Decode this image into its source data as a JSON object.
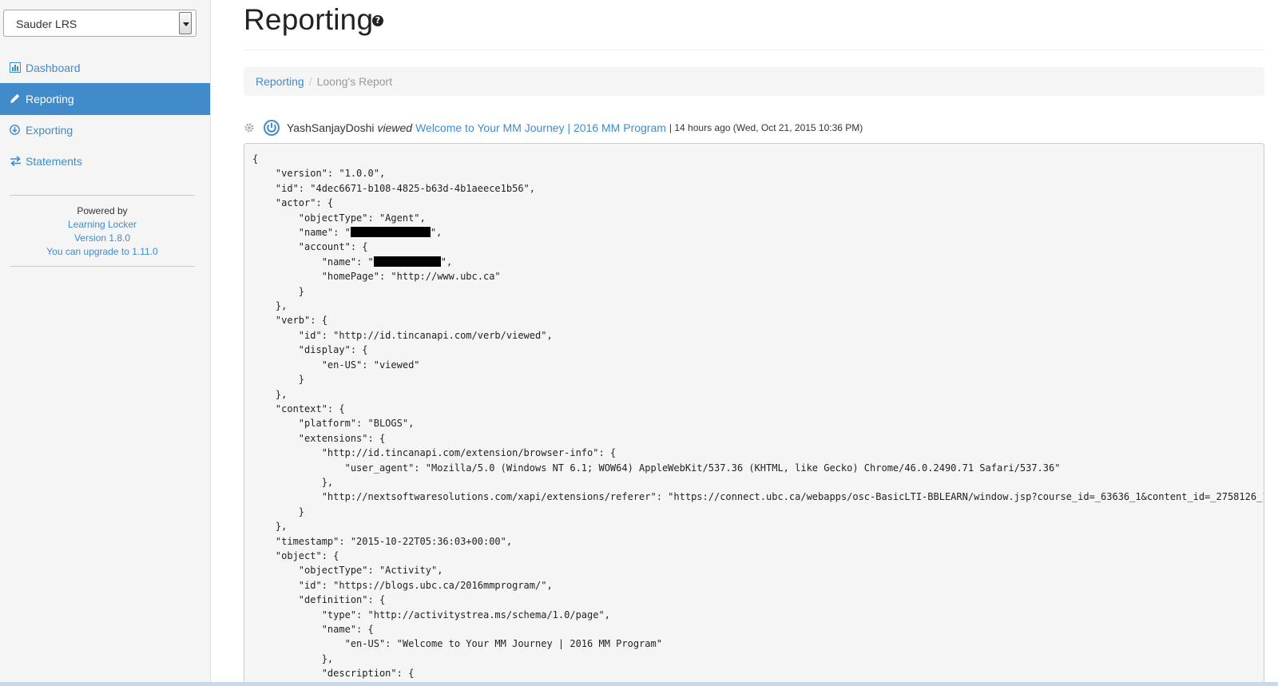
{
  "sidebar": {
    "lrs_selector": {
      "value": "Sauder LRS"
    },
    "nav": [
      {
        "label": "Dashboard",
        "icon": "bar-chart-icon",
        "active": false
      },
      {
        "label": "Reporting",
        "icon": "pencil-icon",
        "active": true
      },
      {
        "label": "Exporting",
        "icon": "download-circle-icon",
        "active": false
      },
      {
        "label": "Statements",
        "icon": "transfer-arrows-icon",
        "active": false
      }
    ],
    "powered": {
      "line1": "Powered by",
      "product": "Learning Locker",
      "version": "Version 1.8.0",
      "upgrade": "You can upgrade to 1.11.0"
    }
  },
  "header": {
    "title": "Reporting",
    "help_icon": "question-circle-icon"
  },
  "breadcrumb": {
    "parent": "Reporting",
    "separator": "/",
    "current": "Loong's Report"
  },
  "statement": {
    "actor": "YashSanjayDoshi",
    "verb": "viewed",
    "object": "Welcome to Your MM Journey | 2016 MM Program",
    "time": "| 14 hours ago (Wed, Oct 21, 2015 10:36 PM)"
  },
  "json_lines": [
    "{",
    "    \"version\": \"1.0.0\",",
    "    \"id\": \"4dec6671-b108-4825-b63d-4b1aeece1b56\",",
    "    \"actor\": {",
    "        \"objectType\": \"Agent\",",
    "        \"name\": \"",
    "        \"account\": {",
    "            \"name\": \"",
    "            \"homePage\": \"http://www.ubc.ca\"",
    "        }",
    "    },",
    "    \"verb\": {",
    "        \"id\": \"http://id.tincanapi.com/verb/viewed\",",
    "        \"display\": {",
    "            \"en-US\": \"viewed\"",
    "        }",
    "    },",
    "    \"context\": {",
    "        \"platform\": \"BLOGS\",",
    "        \"extensions\": {",
    "            \"http://id.tincanapi.com/extension/browser-info\": {",
    "                \"user_agent\": \"Mozilla/5.0 (Windows NT 6.1; WOW64) AppleWebKit/537.36 (KHTML, like Gecko) Chrome/46.0.2490.71 Safari/537.36\"",
    "            },",
    "            \"http://nextsoftwaresolutions.com/xapi/extensions/referer\": \"https://connect.ubc.ca/webapps/osc-BasicLTI-BBLEARN/window.jsp?course_id=_63636_1&content_id=_2758126_1&id=ubc",
    "        }",
    "    },",
    "    \"timestamp\": \"2015-10-22T05:36:03+00:00\",",
    "    \"object\": {",
    "        \"objectType\": \"Activity\",",
    "        \"id\": \"https://blogs.ubc.ca/2016mmprogram/\",",
    "        \"definition\": {",
    "            \"type\": \"http://activitystrea.ms/schema/1.0/page\",",
    "            \"name\": {",
    "                \"en-US\": \"Welcome to Your MM Journey | 2016 MM Program\"",
    "            },",
    "            \"description\": {"
  ],
  "redacted_suffix": "\",",
  "colors": {
    "accent": "#428bca",
    "sidebar_bg": "#f5f5f5",
    "code_bg": "#f5f5f5"
  }
}
